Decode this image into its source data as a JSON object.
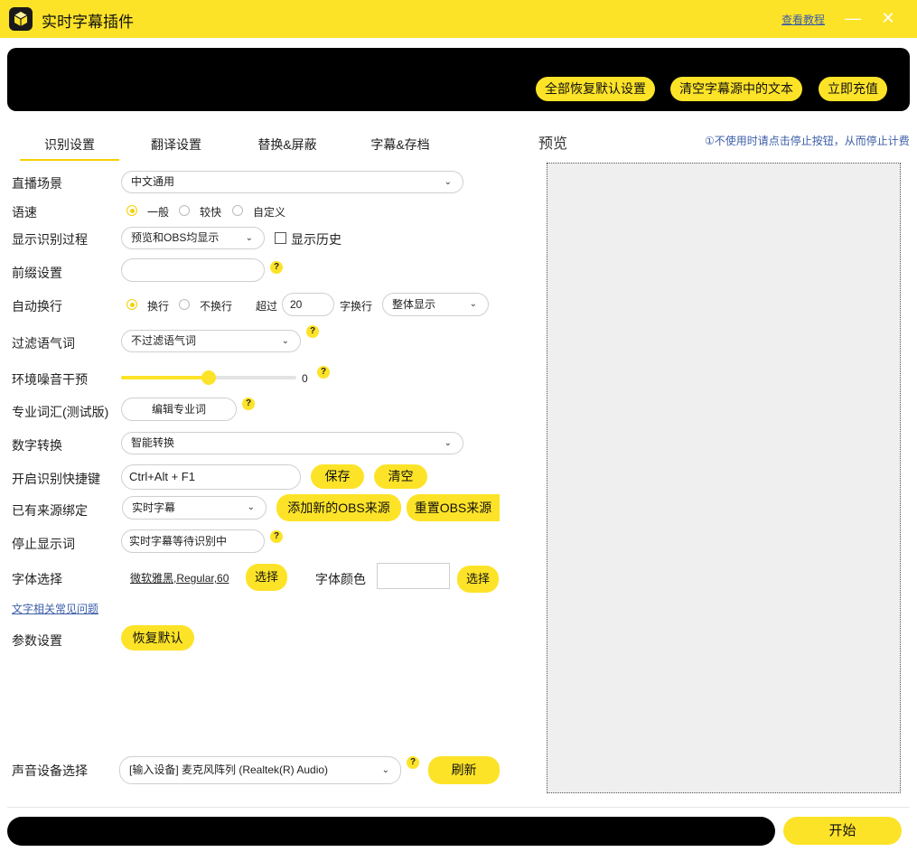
{
  "window": {
    "title": "实时字幕插件",
    "help_link": "查看教程",
    "minimize": "—",
    "close": "✕"
  },
  "banner": {
    "reset_all": "全部恢复默认设置",
    "clear_source": "清空字幕源中的文本",
    "recharge": "立即充值"
  },
  "tabs": [
    "识别设置",
    "翻译设置",
    "替换&屏蔽",
    "字幕&存档"
  ],
  "form": {
    "scene": {
      "label": "直播场景",
      "value": "中文通用"
    },
    "speed": {
      "label": "语速",
      "options": [
        "一般",
        "较快",
        "自定义"
      ],
      "selected": "一般"
    },
    "show_process": {
      "label": "显示识别过程",
      "value": "预览和OBS均显示",
      "history_label": "显示历史",
      "history_checked": false
    },
    "prefix": {
      "label": "前缀设置",
      "value": ""
    },
    "auto_wrap": {
      "label": "自动换行",
      "options": [
        "换行",
        "不换行"
      ],
      "selected": "换行",
      "over_label": "超过",
      "count": "20",
      "unit_label": "字换行",
      "mode": "整体显示"
    },
    "filter": {
      "label": "过滤语气词",
      "value": "不过滤语气词"
    },
    "noise": {
      "label": "环境噪音干预",
      "value": 0,
      "fraction": 0.5
    },
    "vocab": {
      "label": "专业词汇(测试版)",
      "button": "编辑专业词"
    },
    "number": {
      "label": "数字转换",
      "value": "智能转换"
    },
    "hotkey": {
      "label": "开启识别快捷键",
      "value": "Ctrl+Alt + F1",
      "save": "保存",
      "clear": "清空"
    },
    "source": {
      "label": "已有来源绑定",
      "value": "实时字幕",
      "add": "添加新的OBS来源",
      "reset": "重置OBS来源"
    },
    "stop_text": {
      "label": "停止显示词",
      "value": "实时字幕等待识别中"
    },
    "font": {
      "label": "字体选择",
      "value": "微软雅黑,Regular,60",
      "choose": "选择",
      "color_label": "字体颜色",
      "color_choose": "选择",
      "color_value": "#ffffff"
    },
    "font_faq": "文字相关常见问题",
    "params": {
      "label": "参数设置",
      "button": "恢复默认"
    },
    "audio": {
      "label": "声音设备选择",
      "value": "[输入设备] 麦克风阵列 (Realtek(R) Audio)",
      "refresh": "刷新"
    }
  },
  "help_mark": "?",
  "preview": {
    "title": "预览",
    "note": "①不使用时请点击停止按钮，从而停止计费"
  },
  "start_button": "开始",
  "colors": {
    "accent": "#fde328",
    "banner": "#000000",
    "link": "#3c5ea8",
    "preview_bg": "#efefef"
  }
}
